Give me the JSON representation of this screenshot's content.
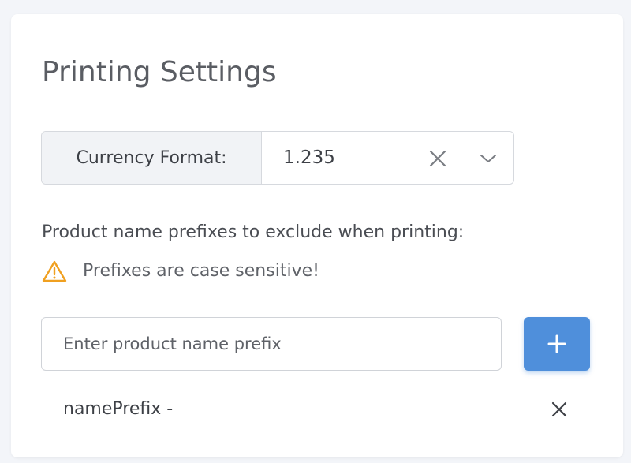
{
  "settings": {
    "title": "Printing Settings",
    "currency": {
      "label": "Currency Format:",
      "value": "1.235"
    },
    "prefixes": {
      "label": "Product name prefixes to exclude when printing:",
      "warning": "Prefixes are case sensitive!",
      "input_placeholder": "Enter product name prefix",
      "input_value": "",
      "items": [
        {
          "text": "namePrefix -"
        }
      ]
    }
  },
  "icons": {
    "clear": "close-icon",
    "dropdown": "chevron-down-icon",
    "warning": "warning-triangle-icon",
    "add": "plus-icon",
    "remove": "close-icon"
  },
  "colors": {
    "accent": "#4f8fdb",
    "warning": "#f0a020",
    "text": "#3d4046",
    "label_bg": "#f1f3f6"
  }
}
